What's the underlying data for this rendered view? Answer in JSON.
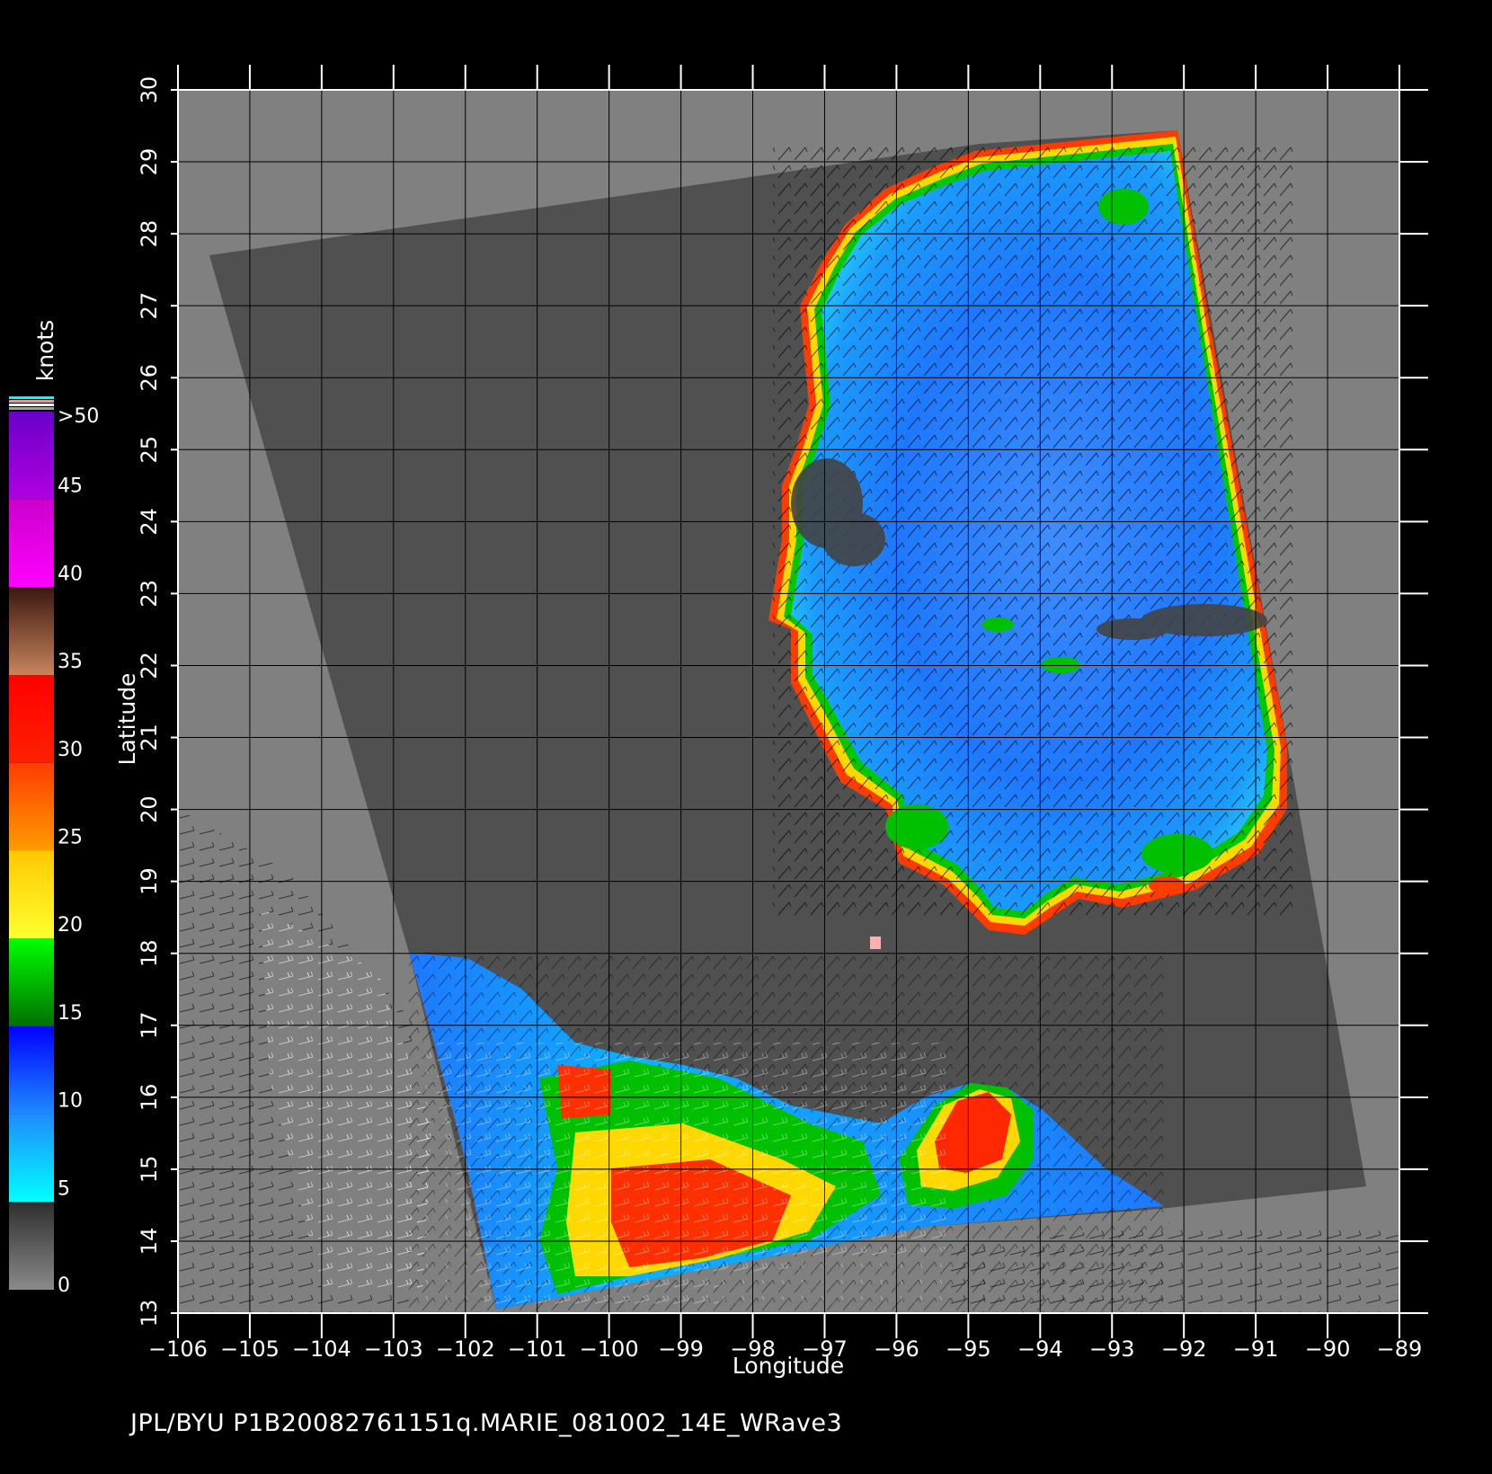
{
  "map": {
    "x_axis_label": "Longitude",
    "y_axis_label": "Latitude",
    "lon_ticks": [
      "-106",
      "-105",
      "-104",
      "-103",
      "-102",
      "-101",
      "-100",
      "-99",
      "-98",
      "-97",
      "-96",
      "-95",
      "-94",
      "-93",
      "-92",
      "-91",
      "-90",
      "-89"
    ],
    "lat_ticks": [
      "13",
      "14",
      "15",
      "16",
      "17",
      "18",
      "19",
      "20",
      "21",
      "22",
      "23",
      "24",
      "25",
      "26",
      "27",
      "28",
      "29",
      "30"
    ],
    "lon_range": [
      -106,
      -89
    ],
    "lat_range": [
      13,
      30
    ],
    "grid": true,
    "colors": {
      "background": "#000000",
      "land_gray": "#808080",
      "swath_gray": "#505050",
      "grid_line": "#000000",
      "frame": "#ffffff"
    }
  },
  "colorbar": {
    "title": "knots",
    "tick_labels": [
      ">50",
      "45",
      "40",
      "35",
      "30",
      "25",
      "20",
      "15",
      "10",
      "5",
      "0"
    ],
    "segments": [
      {
        "from": 0,
        "to": 5,
        "color_top": "#2e2e2e",
        "color_bottom": "#8a8a8a"
      },
      {
        "from": 5,
        "to": 10,
        "color_top": "#1e8cff",
        "color_bottom": "#00ffff"
      },
      {
        "from": 10,
        "to": 15,
        "color_top": "#0000ff",
        "color_bottom": "#1e8cff"
      },
      {
        "from": 15,
        "to": 20,
        "color_top": "#00ff00",
        "color_bottom": "#007000"
      },
      {
        "from": 20,
        "to": 25,
        "color_top": "#ffc800",
        "color_bottom": "#ffff30"
      },
      {
        "from": 25,
        "to": 30,
        "color_top": "#ff3c00",
        "color_bottom": "#ff9c00"
      },
      {
        "from": 30,
        "to": 35,
        "color_top": "#ff0000",
        "color_bottom": "#ff2000"
      },
      {
        "from": 35,
        "to": 40,
        "color_top": "#3a1810",
        "color_bottom": "#c8845c"
      },
      {
        "from": 40,
        "to": 45,
        "color_top": "#cc00cc",
        "color_bottom": "#ff00ff"
      },
      {
        "from": 45,
        "to": 50,
        "color_top": "#6a00c8",
        "color_bottom": "#b000e0"
      }
    ]
  },
  "footer": {
    "text": "JPL/BYU  P1B20082761151q.MARIE_081002_14E_WRave3"
  }
}
